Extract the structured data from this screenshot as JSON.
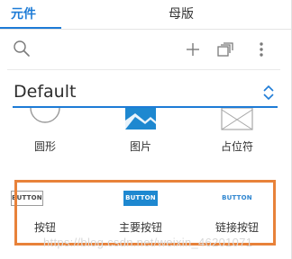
{
  "tabs": [
    {
      "label": "元件",
      "active": true
    },
    {
      "label": "母版",
      "active": false
    }
  ],
  "toolbar": {
    "icons": [
      "search-icon",
      "add-icon",
      "pages-icon",
      "more-vertical-icon"
    ]
  },
  "library": {
    "selected": "Default"
  },
  "widgets": [
    {
      "label": "圆形",
      "icon": "circle-icon"
    },
    {
      "label": "图片",
      "icon": "image-icon"
    },
    {
      "label": "占位符",
      "icon": "placeholder-icon"
    },
    {
      "label": "按钮",
      "preview": "BUTTON"
    },
    {
      "label": "主要按钮",
      "preview": "BUTTON"
    },
    {
      "label": "链接按钮",
      "preview": "BUTTON"
    }
  ],
  "colors": {
    "accent": "#1d7bd6",
    "highlight": "#e8823a",
    "primary_button": "#1e88d0"
  },
  "watermark": "https://blog.csdn.net/weixin_46201071"
}
